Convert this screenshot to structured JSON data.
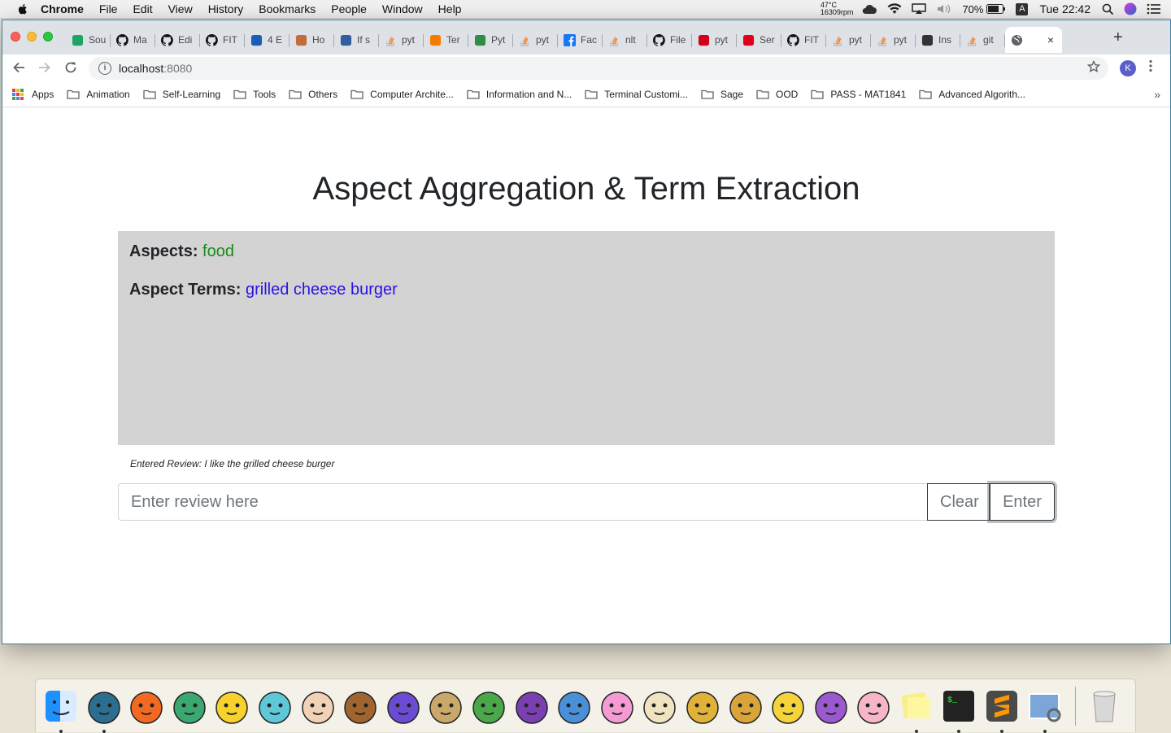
{
  "menubar": {
    "app": "Chrome",
    "items": [
      "File",
      "Edit",
      "View",
      "History",
      "Bookmarks",
      "People",
      "Window",
      "Help"
    ],
    "temp": "47°C",
    "rpm": "16309rpm",
    "battery": "70%",
    "input_source": "A",
    "clock": "Tue 22:42"
  },
  "tabs": [
    {
      "label": "Sou",
      "icon": "google-drive-icon",
      "color": "#1fa463"
    },
    {
      "label": "Ma",
      "icon": "github-icon",
      "color": "#111111"
    },
    {
      "label": "Edi",
      "icon": "github-icon",
      "color": "#111111"
    },
    {
      "label": "FIT",
      "icon": "github-icon",
      "color": "#111111"
    },
    {
      "label": "4 E",
      "icon": "editor-icon",
      "color": "#1b5fb5"
    },
    {
      "label": "Ho",
      "icon": "hand-icon",
      "color": "#c46b3a"
    },
    {
      "label": "If s",
      "icon": "mountain-icon",
      "color": "#2f5f9e"
    },
    {
      "label": "pyt",
      "icon": "stackoverflow-icon",
      "color": "#f48024"
    },
    {
      "label": "Ter",
      "icon": "arrow-icon",
      "color": "#f57c00"
    },
    {
      "label": "Pyt",
      "icon": "gfg-icon",
      "color": "#2f8d46"
    },
    {
      "label": "pyt",
      "icon": "stackoverflow-icon",
      "color": "#f48024"
    },
    {
      "label": "Fac",
      "icon": "facebook-icon",
      "color": "#1877f2"
    },
    {
      "label": "nlt",
      "icon": "stackoverflow-icon",
      "color": "#f48024"
    },
    {
      "label": "File",
      "icon": "github-icon",
      "color": "#111111"
    },
    {
      "label": "pyt",
      "icon": "n-icon",
      "color": "#d0021b"
    },
    {
      "label": "Ser",
      "icon": "car-icon",
      "color": "#e0001b"
    },
    {
      "label": "FIT",
      "icon": "github-icon",
      "color": "#111111"
    },
    {
      "label": "pyt",
      "icon": "stackoverflow-icon",
      "color": "#f48024"
    },
    {
      "label": "pyt",
      "icon": "stackoverflow-icon",
      "color": "#f48024"
    },
    {
      "label": "Ins",
      "icon": "book-icon",
      "color": "#333333"
    },
    {
      "label": "git",
      "icon": "stackoverflow-icon",
      "color": "#f48024"
    }
  ],
  "active_tab": {
    "icon": "globe-icon",
    "close": "×"
  },
  "new_tab": "+",
  "omnibox": {
    "host": "localhost",
    "port": ":8080"
  },
  "profile_initial": "K",
  "bookmarks": [
    "Apps",
    "Animation",
    "Self-Learning",
    "Tools",
    "Others",
    "Computer Archite...",
    "Information and N...",
    "Terminal Customi...",
    "Sage",
    "OOD",
    "PASS - MAT1841",
    "Advanced Algorith..."
  ],
  "bookmarks_more": "»",
  "page": {
    "title": "Aspect Aggregation & Term Extraction",
    "aspects_label": "Aspects:",
    "aspects_value": "food",
    "terms_label": "Aspect Terms:",
    "terms_value": "grilled cheese burger",
    "entered_review": "Entered Review: I like the grilled cheese burger",
    "input_placeholder": "Enter review here",
    "input_value": "",
    "clear_label": "Clear",
    "enter_label": "Enter",
    "colors": {
      "aspects": "#1a8a1a",
      "terms": "#2a12e6",
      "panel": "#d3d3d3"
    }
  },
  "dock": {
    "items": [
      {
        "name": "finder-icon",
        "color": "#1e90ff",
        "running": true
      },
      {
        "name": "snorlax-icon",
        "color": "#2c6e8f",
        "running": true
      },
      {
        "name": "charmander-icon",
        "color": "#f26a21",
        "running": false
      },
      {
        "name": "bulbasaur-icon",
        "color": "#3aa870",
        "running": false
      },
      {
        "name": "pikachu-icon",
        "color": "#f7d22c",
        "running": false
      },
      {
        "name": "squirtle-icon",
        "color": "#5ec8d8",
        "running": false
      },
      {
        "name": "mankey-icon",
        "color": "#f1d2b6",
        "running": false
      },
      {
        "name": "eevee-icon",
        "color": "#a0642e",
        "running": false
      },
      {
        "name": "zubat-icon",
        "color": "#6b4bd1",
        "running": false
      },
      {
        "name": "drill-icon",
        "color": "#c9a86a",
        "running": false
      },
      {
        "name": "xatu-icon",
        "color": "#4aa84a",
        "running": false
      },
      {
        "name": "grimer-icon",
        "color": "#7a3fb0",
        "running": false
      },
      {
        "name": "dratini-icon",
        "color": "#4a90d9",
        "running": false
      },
      {
        "name": "jigglypuff-icon",
        "color": "#f59ad3",
        "running": false
      },
      {
        "name": "meowth-icon",
        "color": "#efe3c0",
        "running": false
      },
      {
        "name": "abra-icon",
        "color": "#e0b23a",
        "running": false
      },
      {
        "name": "kadabra-icon",
        "color": "#d9a43a",
        "running": false
      },
      {
        "name": "psyduck-icon",
        "color": "#f5d33a",
        "running": false
      },
      {
        "name": "rattata-icon",
        "color": "#9b59d0",
        "running": false
      },
      {
        "name": "mew-icon",
        "color": "#f7b6c8",
        "running": false
      },
      {
        "name": "stickies-icon",
        "color": "#f7ef8a",
        "running": true
      },
      {
        "name": "terminal-icon",
        "color": "#222222",
        "running": true
      },
      {
        "name": "sublime-text-icon",
        "color": "#ff9800",
        "running": true
      },
      {
        "name": "preview-icon",
        "color": "#7aa7d8",
        "running": true
      },
      {
        "name": "trash-icon",
        "color": "#d8d8d8",
        "running": false
      }
    ]
  }
}
